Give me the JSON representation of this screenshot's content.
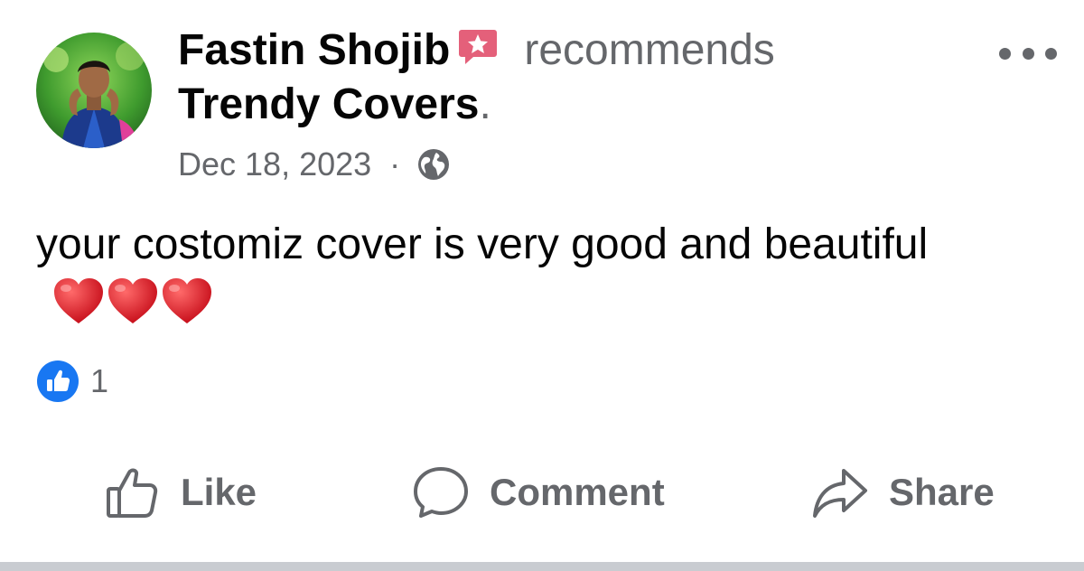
{
  "post": {
    "author": "Fastin Shojib",
    "action": "recommends",
    "page": "Trendy Covers",
    "period": ".",
    "date": "Dec 18, 2023",
    "separator": "·",
    "privacy_icon": "globe-icon",
    "text": "your costomiz cover is very good and beautiful",
    "emoji_icons": [
      "heart-icon",
      "heart-icon",
      "heart-icon"
    ],
    "reaction_icon": "like-reaction-icon",
    "reaction_count": "1"
  },
  "actions": {
    "like_label": "Like",
    "comment_label": "Comment",
    "share_label": "Share"
  },
  "colors": {
    "text": "#050505",
    "secondary_text": "#65676b",
    "like_blue": "#1877f2",
    "badge_pink": "#e4607a",
    "heart_red": "#e0202e"
  }
}
